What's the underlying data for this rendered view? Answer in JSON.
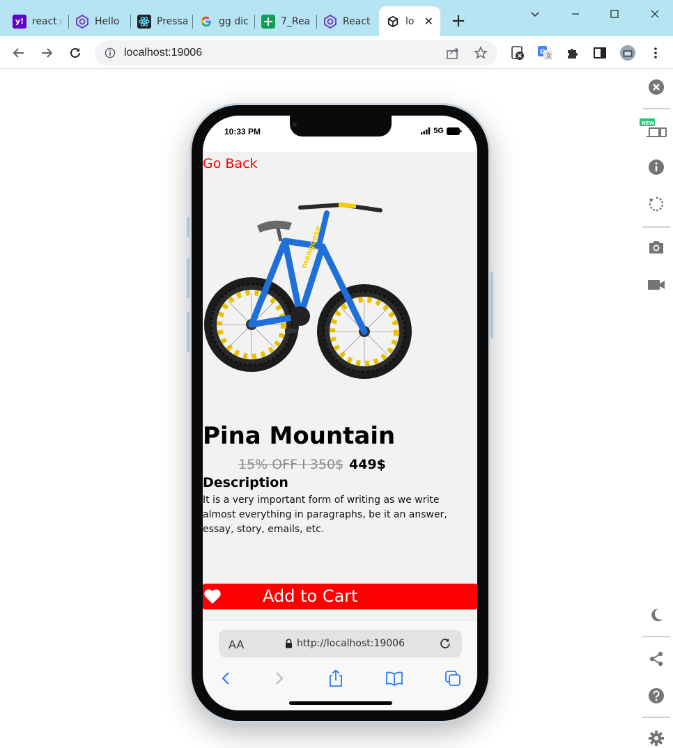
{
  "browser": {
    "tabs": [
      {
        "label": "react r",
        "icon": "yahoo-icon"
      },
      {
        "label": "Hello",
        "icon": "blazor-icon"
      },
      {
        "label": "Pressa",
        "icon": "react-icon"
      },
      {
        "label": "gg dic",
        "icon": "google-icon"
      },
      {
        "label": "7_Rea",
        "icon": "sheets-icon"
      },
      {
        "label": "React",
        "icon": "blazor-icon"
      },
      {
        "label": "lo",
        "icon": "cube-icon",
        "active": true
      }
    ],
    "url": "localhost:19006"
  },
  "phone": {
    "status": {
      "time": "10:33 PM",
      "network": "5G"
    },
    "app": {
      "go_back": "Go Back",
      "product_name": "Pina Mountain",
      "old_price": "15% OFF I 350$",
      "new_price": "449$",
      "description_heading": "Description",
      "description": "It is a very important form of writing as we write almost everything in paragraphs, be it an answer, essay, story, emails, etc.",
      "cart_button": "Add to Cart",
      "accent_color": "#ff0000"
    },
    "safari": {
      "text_size_label": "AA",
      "url": "http://localhost:19006"
    }
  },
  "side_panel": {
    "new_badge": "NEW"
  }
}
